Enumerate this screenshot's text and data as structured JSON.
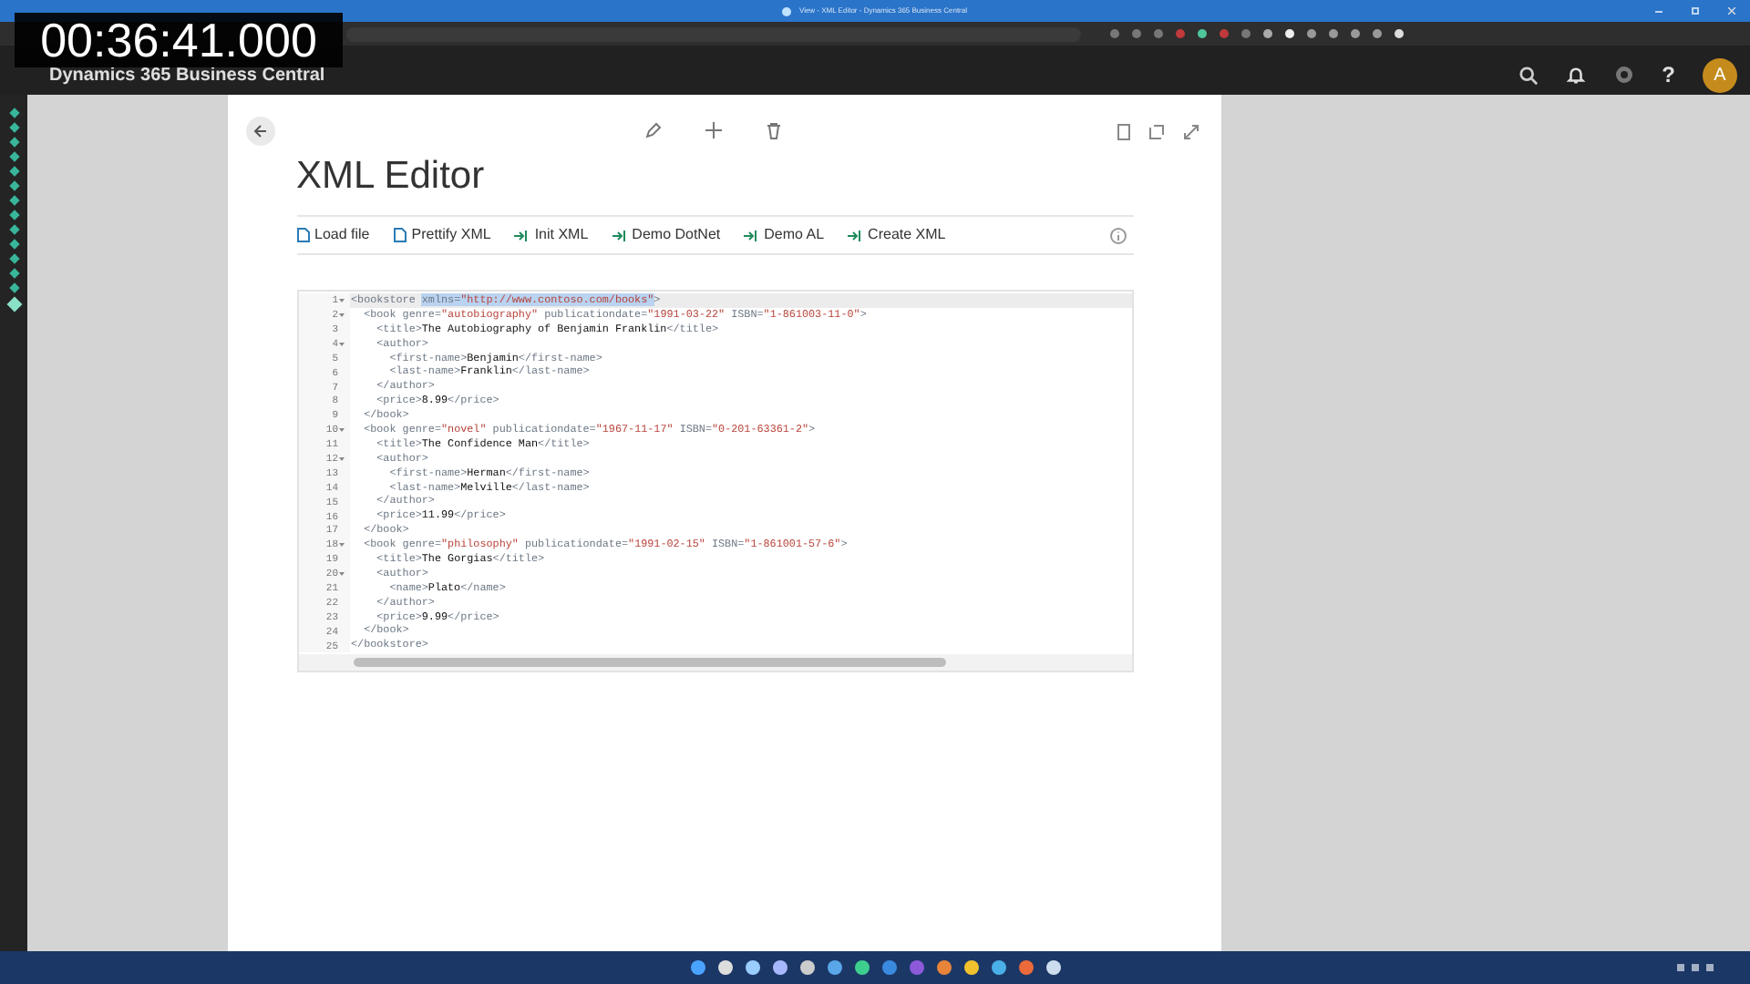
{
  "window": {
    "title": "View - XML Editor - Dynamics 365 Business Central"
  },
  "timestamp": "00:36:41.000",
  "app": {
    "title": "Dynamics 365 Business Central",
    "help": "?",
    "avatar": "A"
  },
  "page": {
    "title": "XML Editor",
    "actions": [
      {
        "label": "Load file",
        "kind": "file"
      },
      {
        "label": "Prettify XML",
        "kind": "file"
      },
      {
        "label": "Init XML",
        "kind": "run"
      },
      {
        "label": "Demo DotNet",
        "kind": "run"
      },
      {
        "label": "Demo AL",
        "kind": "run"
      },
      {
        "label": "Create XML",
        "kind": "run"
      }
    ],
    "editor": {
      "lines": [
        {
          "number": "1",
          "foldable": true,
          "active": true,
          "tokens": [
            {
              "kind": "tag",
              "text": "<bookstore ",
              "highlighted": false
            },
            {
              "kind": "attr",
              "text": "xmlns=",
              "highlighted": true
            },
            {
              "kind": "value",
              "text": "\"http://www.contoso.com/books\"",
              "highlighted": true
            },
            {
              "kind": "tag",
              "text": ">",
              "highlighted": false
            }
          ]
        },
        {
          "number": "2",
          "foldable": true,
          "active": false,
          "tokens": [
            {
              "kind": "tag",
              "text": "  <book "
            },
            {
              "kind": "attr",
              "text": "genre="
            },
            {
              "kind": "value",
              "text": "\"autobiography\""
            },
            {
              "kind": "attr",
              "text": " publicationdate="
            },
            {
              "kind": "value",
              "text": "\"1991-03-22\""
            },
            {
              "kind": "attr",
              "text": " ISBN="
            },
            {
              "kind": "value",
              "text": "\"1-861003-11-0\""
            },
            {
              "kind": "tag",
              "text": ">"
            }
          ]
        },
        {
          "number": "3",
          "foldable": false,
          "active": false,
          "tokens": [
            {
              "kind": "tag",
              "text": "    <title>"
            },
            {
              "kind": "text",
              "text": "The Autobiography of Benjamin Franklin"
            },
            {
              "kind": "tag",
              "text": "</title>"
            }
          ]
        },
        {
          "number": "4",
          "foldable": true,
          "active": false,
          "tokens": [
            {
              "kind": "tag",
              "text": "    <author>"
            }
          ]
        },
        {
          "number": "5",
          "foldable": false,
          "active": false,
          "tokens": [
            {
              "kind": "tag",
              "text": "      <first-name>"
            },
            {
              "kind": "text",
              "text": "Benjamin"
            },
            {
              "kind": "tag",
              "text": "</first-name>"
            }
          ]
        },
        {
          "number": "6",
          "foldable": false,
          "active": false,
          "tokens": [
            {
              "kind": "tag",
              "text": "      <last-name>"
            },
            {
              "kind": "text",
              "text": "Franklin"
            },
            {
              "kind": "tag",
              "text": "</last-name>"
            }
          ]
        },
        {
          "number": "7",
          "foldable": false,
          "active": false,
          "tokens": [
            {
              "kind": "tag",
              "text": "    </author>"
            }
          ]
        },
        {
          "number": "8",
          "foldable": false,
          "active": false,
          "tokens": [
            {
              "kind": "tag",
              "text": "    <price>"
            },
            {
              "kind": "text",
              "text": "8.99"
            },
            {
              "kind": "tag",
              "text": "</price>"
            }
          ]
        },
        {
          "number": "9",
          "foldable": false,
          "active": false,
          "tokens": [
            {
              "kind": "tag",
              "text": "  </book>"
            }
          ]
        },
        {
          "number": "10",
          "foldable": true,
          "active": false,
          "tokens": [
            {
              "kind": "tag",
              "text": "  <book "
            },
            {
              "kind": "attr",
              "text": "genre="
            },
            {
              "kind": "value",
              "text": "\"novel\""
            },
            {
              "kind": "attr",
              "text": " publicationdate="
            },
            {
              "kind": "value",
              "text": "\"1967-11-17\""
            },
            {
              "kind": "attr",
              "text": " ISBN="
            },
            {
              "kind": "value",
              "text": "\"0-201-63361-2\""
            },
            {
              "kind": "tag",
              "text": ">"
            }
          ]
        },
        {
          "number": "11",
          "foldable": false,
          "active": false,
          "tokens": [
            {
              "kind": "tag",
              "text": "    <title>"
            },
            {
              "kind": "text",
              "text": "The Confidence Man"
            },
            {
              "kind": "tag",
              "text": "</title>"
            }
          ]
        },
        {
          "number": "12",
          "foldable": true,
          "active": false,
          "tokens": [
            {
              "kind": "tag",
              "text": "    <author>"
            }
          ]
        },
        {
          "number": "13",
          "foldable": false,
          "active": false,
          "tokens": [
            {
              "kind": "tag",
              "text": "      <first-name>"
            },
            {
              "kind": "text",
              "text": "Herman"
            },
            {
              "kind": "tag",
              "text": "</first-name>"
            }
          ]
        },
        {
          "number": "14",
          "foldable": false,
          "active": false,
          "tokens": [
            {
              "kind": "tag",
              "text": "      <last-name>"
            },
            {
              "kind": "text",
              "text": "Melville"
            },
            {
              "kind": "tag",
              "text": "</last-name>"
            }
          ]
        },
        {
          "number": "15",
          "foldable": false,
          "active": false,
          "tokens": [
            {
              "kind": "tag",
              "text": "    </author>"
            }
          ]
        },
        {
          "number": "16",
          "foldable": false,
          "active": false,
          "tokens": [
            {
              "kind": "tag",
              "text": "    <price>"
            },
            {
              "kind": "text",
              "text": "11.99"
            },
            {
              "kind": "tag",
              "text": "</price>"
            }
          ]
        },
        {
          "number": "17",
          "foldable": false,
          "active": false,
          "tokens": [
            {
              "kind": "tag",
              "text": "  </book>"
            }
          ]
        },
        {
          "number": "18",
          "foldable": true,
          "active": false,
          "tokens": [
            {
              "kind": "tag",
              "text": "  <book "
            },
            {
              "kind": "attr",
              "text": "genre="
            },
            {
              "kind": "value",
              "text": "\"philosophy\""
            },
            {
              "kind": "attr",
              "text": " publicationdate="
            },
            {
              "kind": "value",
              "text": "\"1991-02-15\""
            },
            {
              "kind": "attr",
              "text": " ISBN="
            },
            {
              "kind": "value",
              "text": "\"1-861001-57-6\""
            },
            {
              "kind": "tag",
              "text": ">"
            }
          ]
        },
        {
          "number": "19",
          "foldable": false,
          "active": false,
          "tokens": [
            {
              "kind": "tag",
              "text": "    <title>"
            },
            {
              "kind": "text",
              "text": "The Gorgias"
            },
            {
              "kind": "tag",
              "text": "</title>"
            }
          ]
        },
        {
          "number": "20",
          "foldable": true,
          "active": false,
          "tokens": [
            {
              "kind": "tag",
              "text": "    <author>"
            }
          ]
        },
        {
          "number": "21",
          "foldable": false,
          "active": false,
          "tokens": [
            {
              "kind": "tag",
              "text": "      <name>"
            },
            {
              "kind": "text",
              "text": "Plato"
            },
            {
              "kind": "tag",
              "text": "</name>"
            }
          ]
        },
        {
          "number": "22",
          "foldable": false,
          "active": false,
          "tokens": [
            {
              "kind": "tag",
              "text": "    </author>"
            }
          ]
        },
        {
          "number": "23",
          "foldable": false,
          "active": false,
          "tokens": [
            {
              "kind": "tag",
              "text": "    <price>"
            },
            {
              "kind": "text",
              "text": "9.99"
            },
            {
              "kind": "tag",
              "text": "</price>"
            }
          ]
        },
        {
          "number": "24",
          "foldable": false,
          "active": false,
          "tokens": [
            {
              "kind": "tag",
              "text": "  </book>"
            }
          ]
        },
        {
          "number": "25",
          "foldable": false,
          "active": false,
          "tokens": [
            {
              "kind": "tag",
              "text": "</bookstore>"
            }
          ]
        }
      ]
    }
  }
}
